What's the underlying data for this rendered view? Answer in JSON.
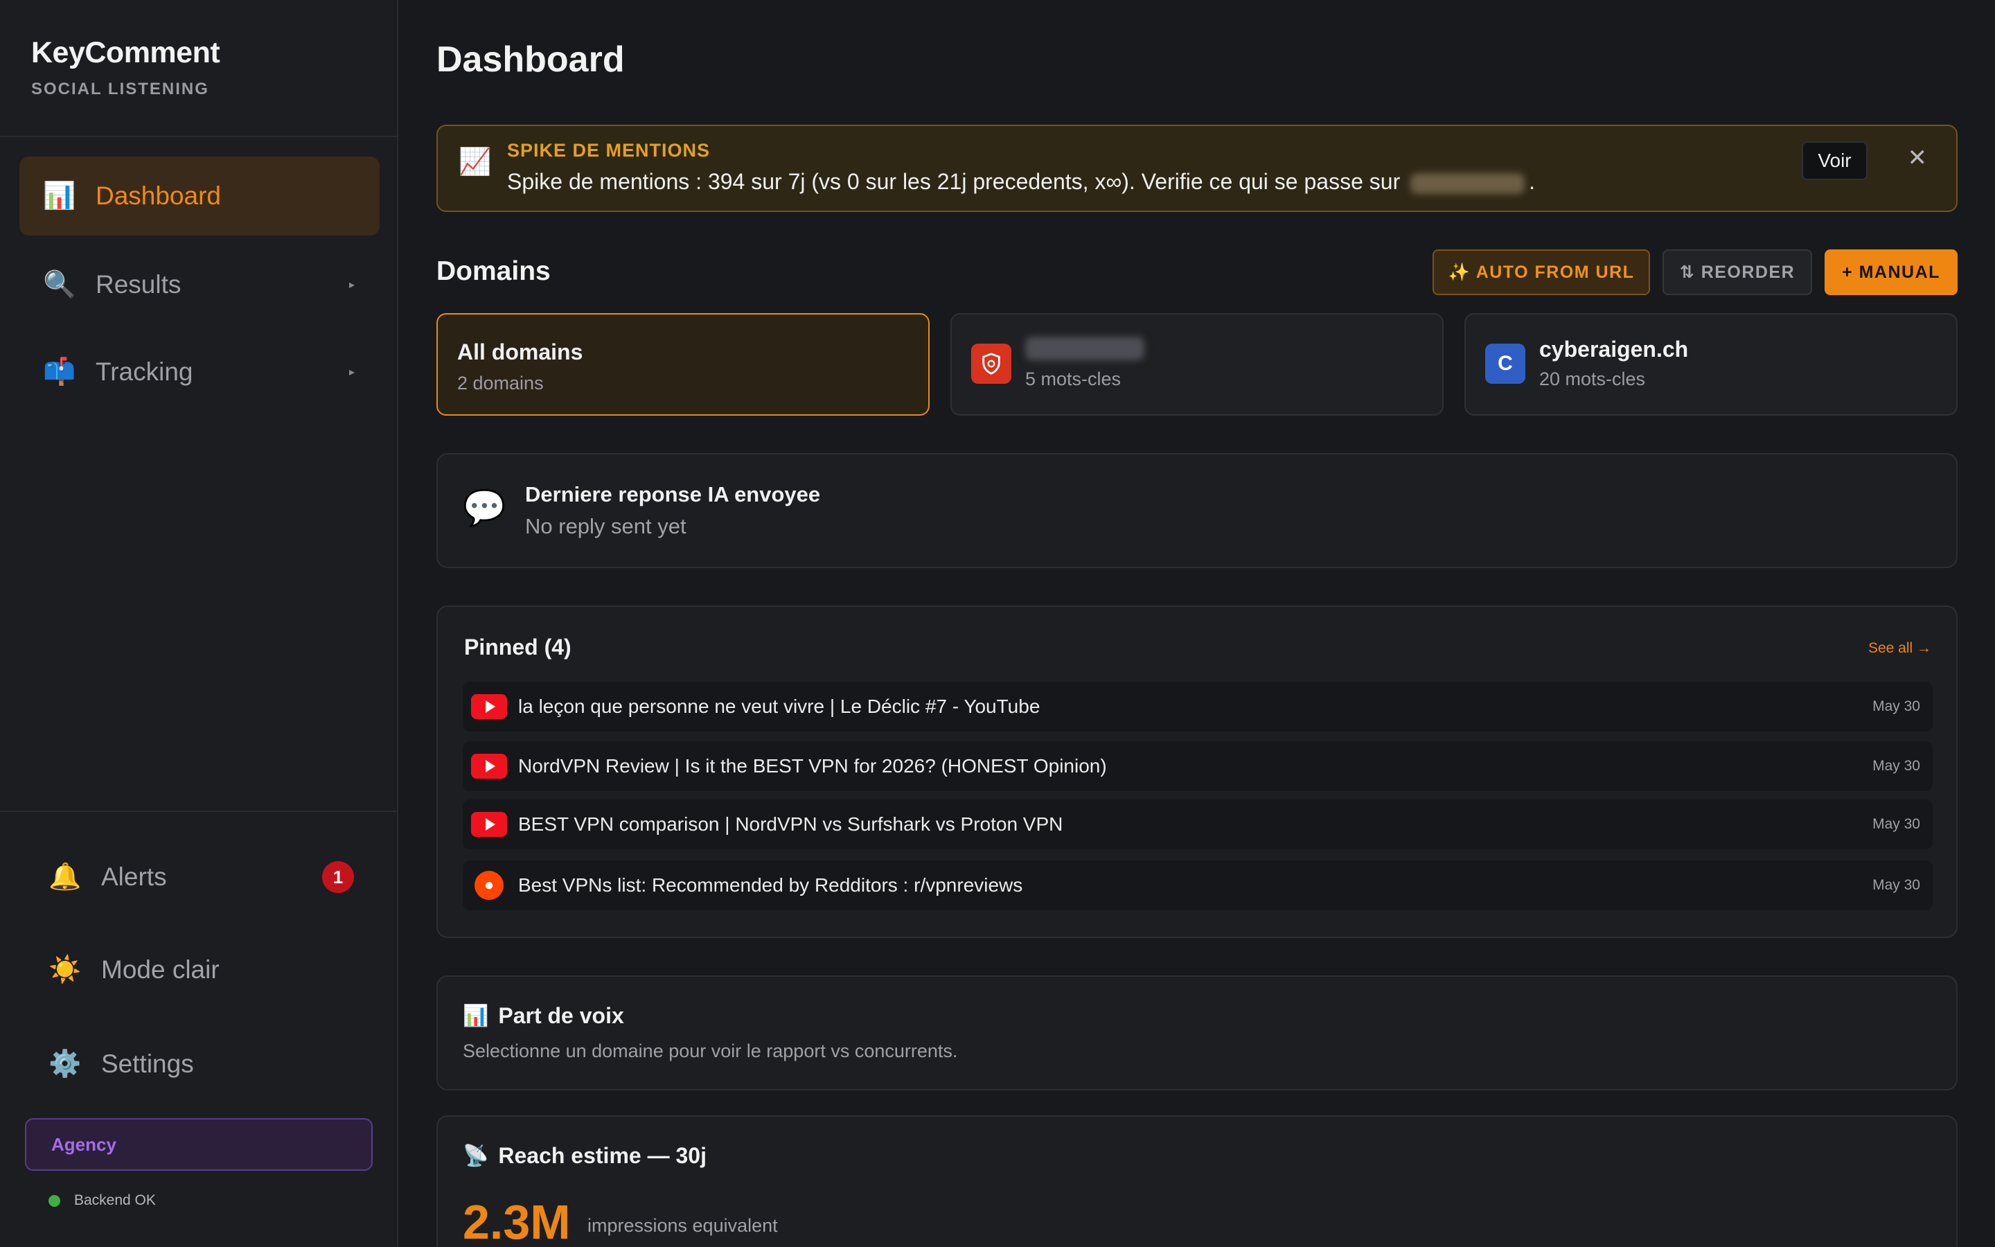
{
  "app": {
    "title": "KeyComment",
    "subtitle": "SOCIAL LISTENING"
  },
  "sidebar": {
    "items": [
      {
        "label": "Dashboard",
        "icon": "bar-chart-icon",
        "active": true
      },
      {
        "label": "Results",
        "icon": "magnifier-icon",
        "caret": "▸"
      },
      {
        "label": "Tracking",
        "icon": "mailbox-icon",
        "caret": "▸"
      }
    ],
    "bottom": [
      {
        "label": "Alerts",
        "icon": "bell-icon",
        "badge": "1"
      },
      {
        "label": "Mode clair",
        "icon": "sun-icon"
      },
      {
        "label": "Settings",
        "icon": "gear-icon"
      }
    ],
    "plan": "Agency",
    "status": "Backend OK"
  },
  "page": {
    "title": "Dashboard"
  },
  "alert": {
    "title": "SPIKE DE MENTIONS",
    "text": "Spike de mentions : 394 sur 7j (vs 0 sur les 21j precedents, x∞). Verifie ce qui se passe sur",
    "suffix": ".",
    "voir": "Voir",
    "close": "✕"
  },
  "domains": {
    "title": "Domains",
    "buttons": {
      "auto": "✨ AUTO FROM URL",
      "reorder": "⇅ REORDER",
      "manual": "+ MANUAL"
    },
    "cards": [
      {
        "name": "All domains",
        "sub": "2 domains"
      },
      {
        "name": "",
        "sub": "5 mots-cles",
        "logo_color": "#d7331f"
      },
      {
        "name": "cyberaigen.ch",
        "sub": "20 mots-cles",
        "logo_letter": "C",
        "logo_color": "#2f5fc4"
      }
    ]
  },
  "reply": {
    "title": "Derniere reponse IA envoyee",
    "sub": "No reply sent yet"
  },
  "pinned": {
    "title": "Pinned (4)",
    "see_all": "See all →",
    "items": [
      {
        "source": "youtube",
        "text": "la leçon que personne ne veut vivre | Le Déclic #7 - YouTube",
        "date": "May 30"
      },
      {
        "source": "youtube",
        "text": "NordVPN Review | Is it the BEST VPN for 2026? (HONEST Opinion)",
        "date": "May 30"
      },
      {
        "source": "youtube",
        "text": "BEST VPN comparison | NordVPN vs Surfshark vs Proton VPN",
        "date": "May 30"
      },
      {
        "source": "reddit",
        "text": "Best VPNs list: Recommended by Redditors : r/vpnreviews",
        "date": "May 30"
      }
    ]
  },
  "share_of_voice": {
    "title": "Part de voix",
    "sub": "Selectionne un domaine pour voir le rapport vs concurrents."
  },
  "reach": {
    "title": "Reach estime — 30j",
    "value": "2.3M",
    "unit": "impressions equivalent"
  }
}
